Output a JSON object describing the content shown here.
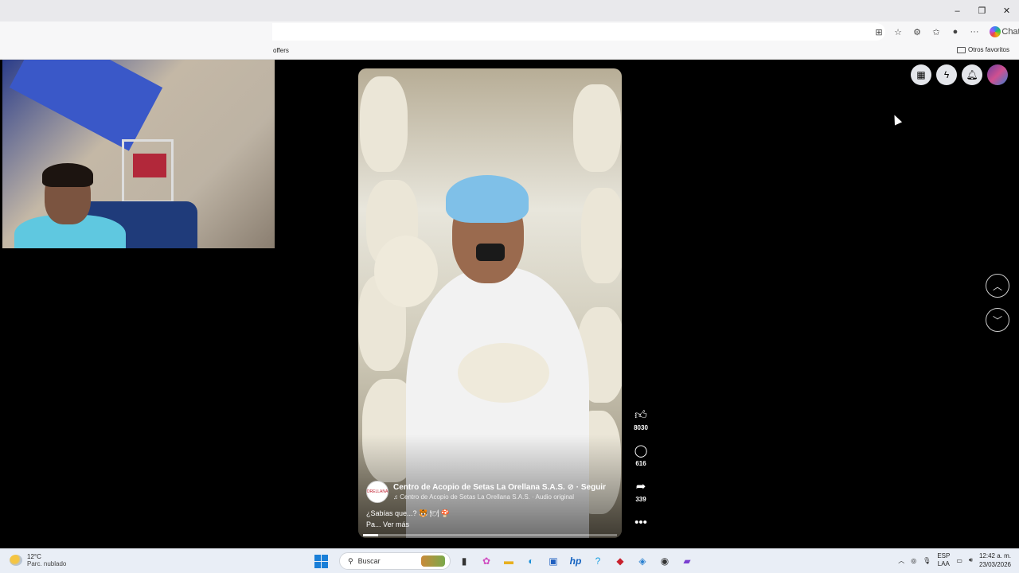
{
  "window": {
    "controls": [
      "–",
      "❐",
      "✕"
    ]
  },
  "toolbar": {
    "chat_label": "Chat",
    "icons": [
      "apps-icon",
      "star-icon",
      "extensions-icon",
      "favorites-icon",
      "profile-icon",
      "more-icon"
    ]
  },
  "favorites": {
    "offers_label": "offers",
    "other_favorites_label": "Otros favoritos"
  },
  "reel": {
    "page_name": "Centro de Acopio de Setas La Orellana S.A.S.",
    "verified_mark": "⊘",
    "follow_label": "· Seguir",
    "audio_label": "♫ Centro de Acopio de Setas La Orellana S.A.S. · Audio original",
    "caption_line1": "¿Sabías que...? 🐯 🍽 🍄",
    "caption_line2": "Pa... Ver más",
    "progress_fraction": 0.06,
    "avatar_text": "ORELLANA"
  },
  "actions": {
    "likes": "8030",
    "comments": "616",
    "shares": "339"
  },
  "fb_nav": {
    "icons": [
      "menu-grid-icon",
      "messenger-icon",
      "notifications-icon",
      "profile-avatar"
    ]
  },
  "taskbar": {
    "temperature": "12°C",
    "weather": "Parc. nublado",
    "search_placeholder": "Buscar",
    "lang_line1": "ESP",
    "lang_line2": "LAA",
    "time": "12:42 a. m.",
    "date": "23/03/2026"
  },
  "colors": {
    "page_background": "#000000",
    "taskbar": "#e9eef6",
    "windows_blue": "#1a7fd8"
  }
}
